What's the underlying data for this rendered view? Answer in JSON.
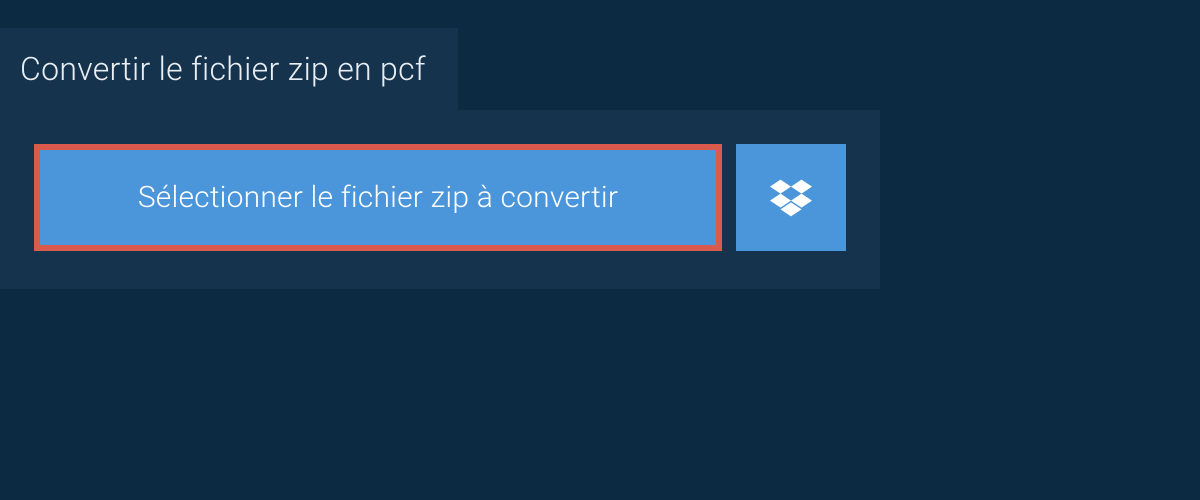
{
  "header": {
    "title": "Convertir le fichier zip en pcf"
  },
  "actions": {
    "select_file_label": "Sélectionner le fichier zip à convertir",
    "dropbox_icon": "dropbox-icon"
  },
  "colors": {
    "background": "#0c2a42",
    "panel": "#15334d",
    "button_primary": "#4b95db",
    "button_highlight_border": "#da5a4b",
    "text_light": "#e8eef3"
  }
}
